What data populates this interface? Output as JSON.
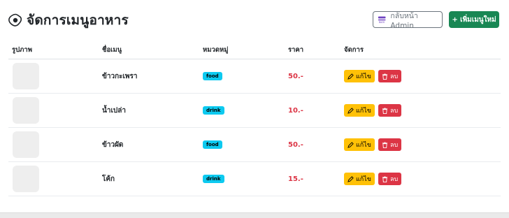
{
  "header": {
    "title": "จัดการเมนูอาหาร",
    "title_icon": "fried-egg-icon",
    "back_label": "กลับหน้า Admin",
    "back_icon": "back-icon",
    "add_label": "+ เพิ่มเมนูใหม่"
  },
  "table": {
    "columns": [
      "รูปภาพ",
      "ชื่อเมนู",
      "หมวดหมู่",
      "ราคา",
      "จัดการ"
    ],
    "rows": [
      {
        "name": "ข้าวกะเพรา",
        "category": "food",
        "price": "50.-"
      },
      {
        "name": "น้ำเปล่า",
        "category": "drink",
        "price": "10.-"
      },
      {
        "name": "ข้าวผัด",
        "category": "food",
        "price": "50.-"
      },
      {
        "name": "โค้ก",
        "category": "drink",
        "price": "15.-"
      }
    ],
    "edit_label": "แก้ไข",
    "delete_label": "ลบ"
  },
  "colors": {
    "primary_add": "#198754",
    "badge": "#0dcaf0",
    "price": "#dc3545",
    "edit": "#ffc107",
    "delete": "#dc3545"
  }
}
